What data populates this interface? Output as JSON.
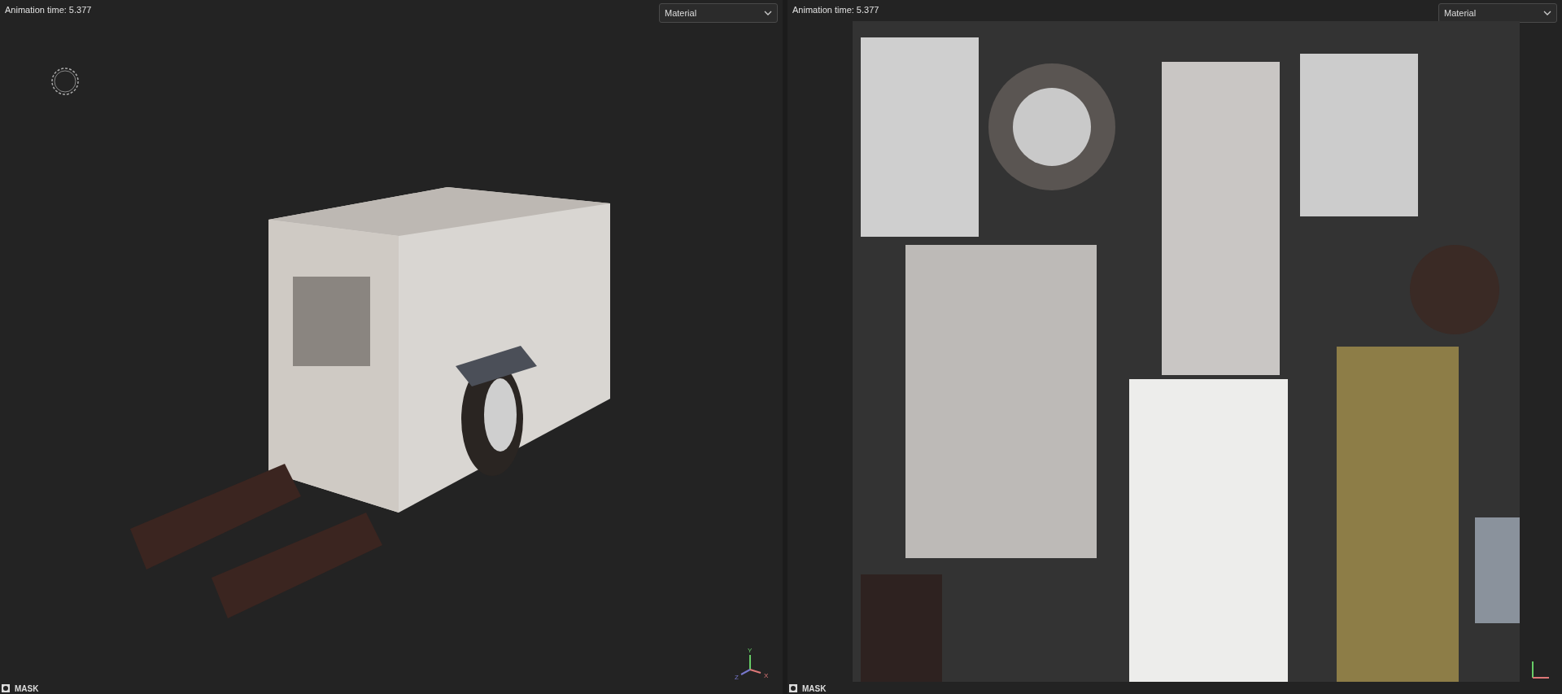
{
  "viewports": [
    {
      "kind": "model",
      "animation_time": "Animation time: 5.377",
      "mode": "Material",
      "axis_labels": [
        "Y",
        "Z",
        "X"
      ],
      "mask_label": "MASK"
    },
    {
      "kind": "uv",
      "animation_time": "Animation time: 5.377",
      "mode": "Material",
      "mask_label": "MASK"
    }
  ]
}
